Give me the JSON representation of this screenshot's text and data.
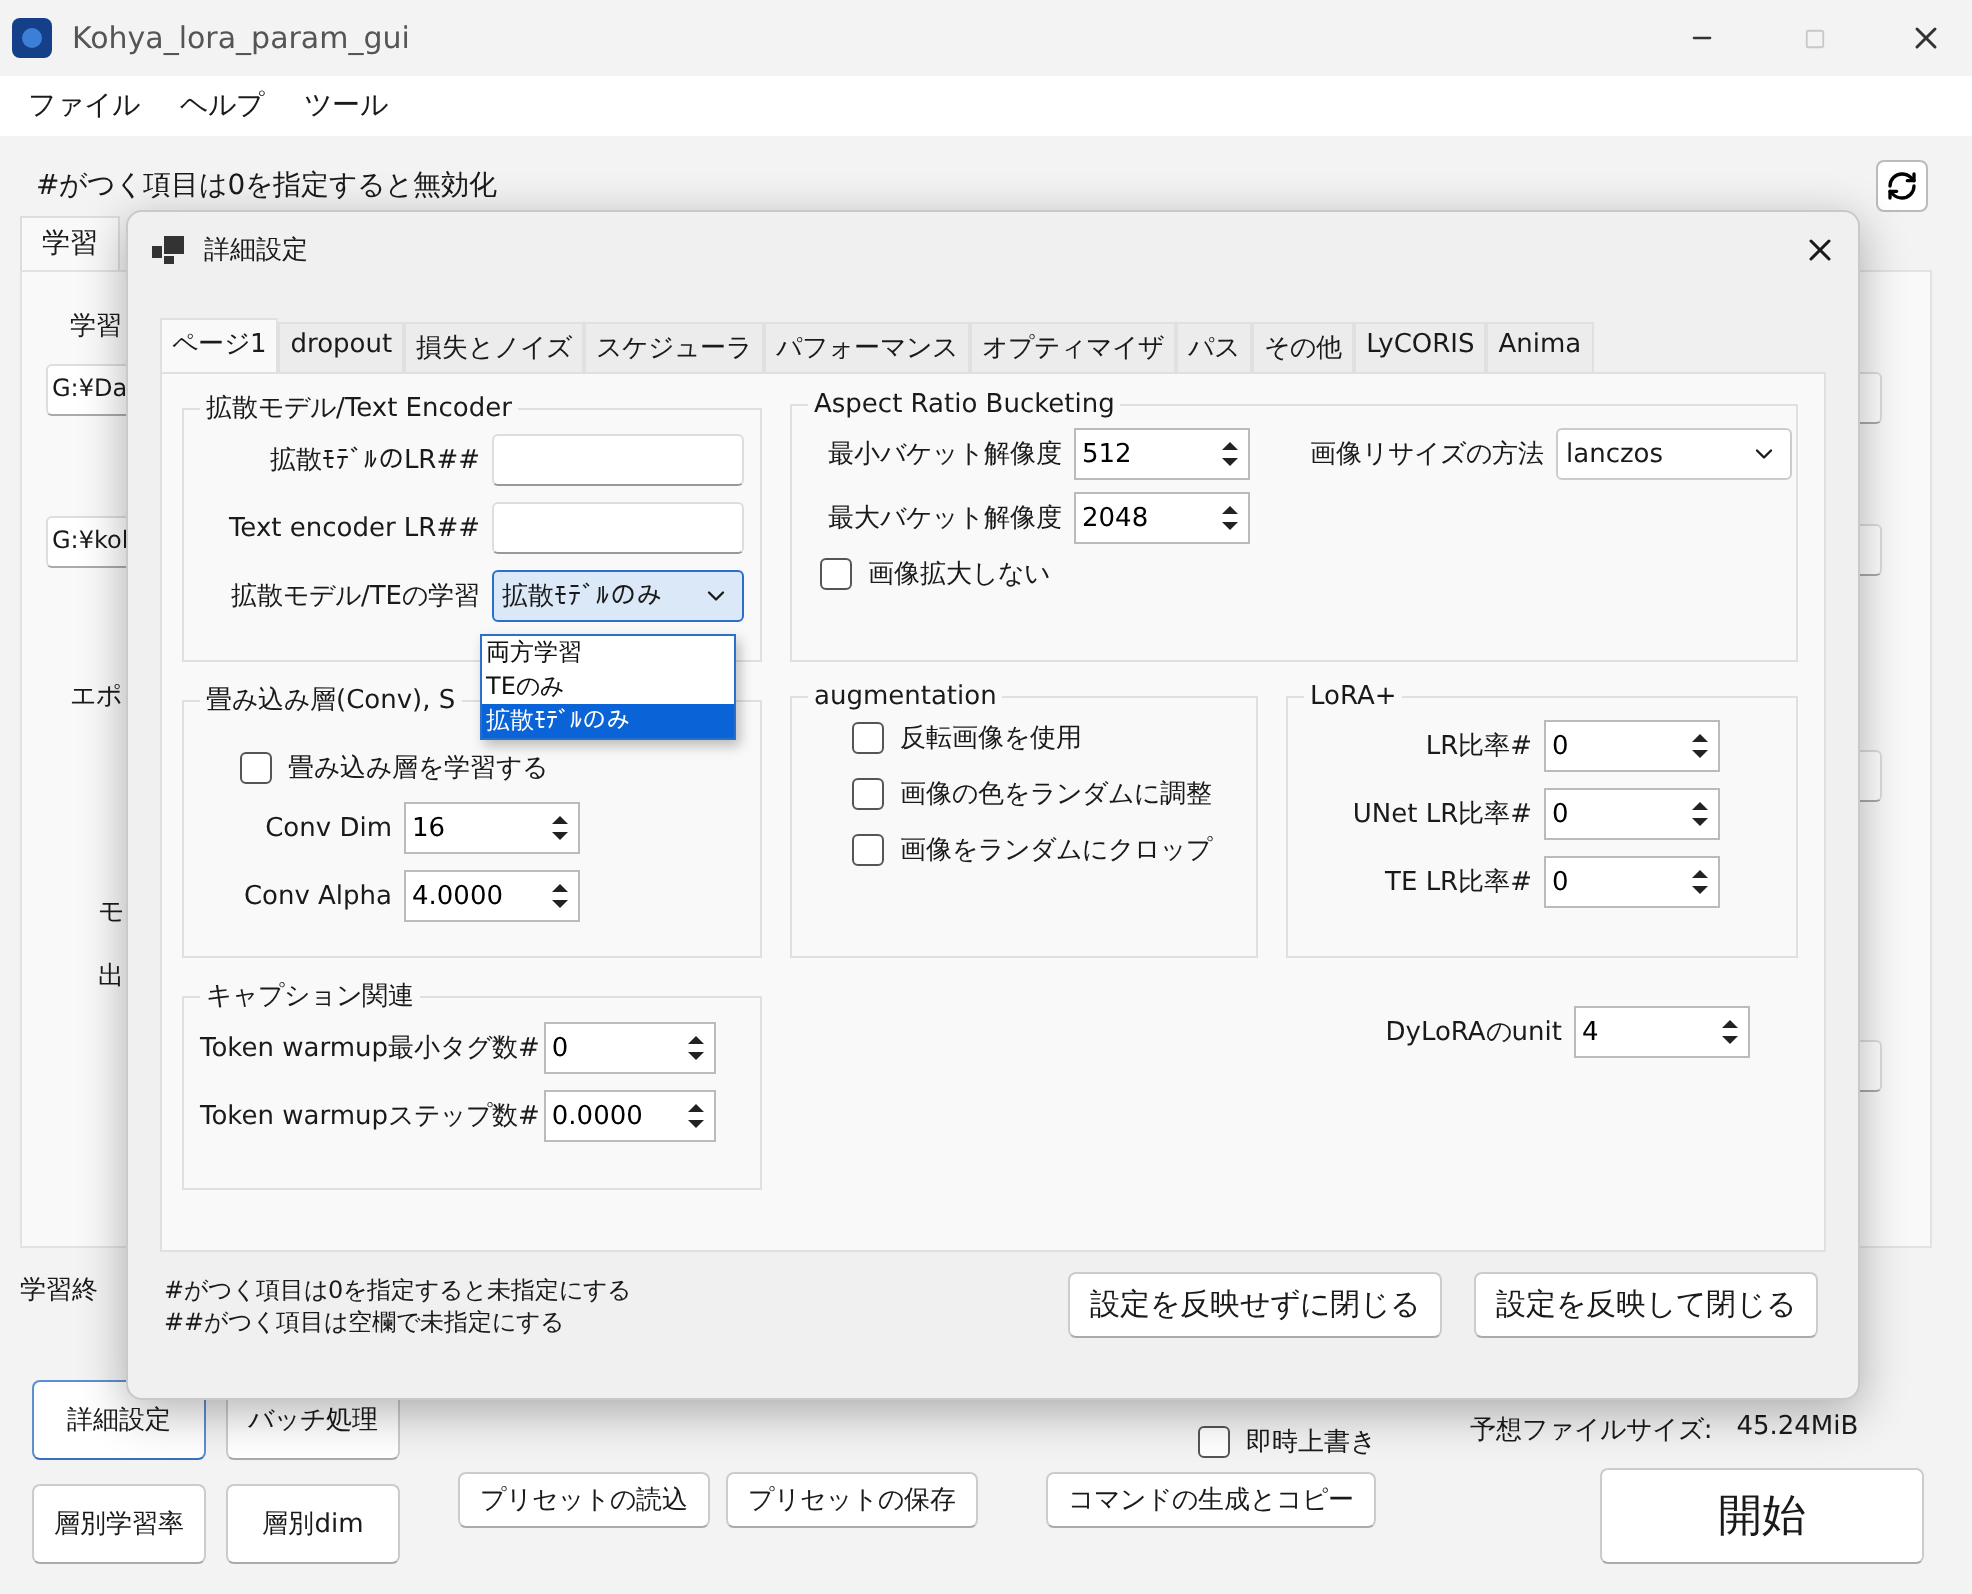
{
  "window": {
    "title": "Kohya_lora_param_gui"
  },
  "menu": [
    "ファイル",
    "ヘルプ",
    "ツール"
  ],
  "main": {
    "hint": "#がつく項目は0を指定すると無効化",
    "tabs": [
      {
        "label": "学習",
        "selected": true
      }
    ],
    "items": [
      {
        "kind": "label",
        "text": "学習"
      },
      {
        "kind": "field",
        "text": "G:¥Da"
      },
      {
        "kind": "field",
        "text": "G:¥kol"
      },
      {
        "kind": "label",
        "text": "エポ"
      },
      {
        "kind": "label",
        "text": "モ"
      },
      {
        "kind": "label",
        "text": "出"
      }
    ],
    "status": "学習終",
    "left_buttons": [
      {
        "label": "詳細設定",
        "focused": true
      },
      {
        "label": "バッチ処理",
        "focused": false
      },
      {
        "label": "層別学習率",
        "focused": false
      },
      {
        "label": "層別dim",
        "focused": false
      }
    ],
    "overwrite": {
      "label": "即時上書き",
      "checked": false
    },
    "file_size": {
      "label": "予想ファイルサイズ:",
      "value": "45.24MiB"
    },
    "preset_buttons": [
      "プリセットの読込",
      "プリセットの保存"
    ],
    "command_button": "コマンドの生成とコピー",
    "start_button": "開始"
  },
  "dialog": {
    "title": "詳細設定",
    "tabs": [
      {
        "label": "ページ1",
        "selected": true
      },
      {
        "label": "dropout",
        "selected": false
      },
      {
        "label": "損失とノイズ",
        "selected": false
      },
      {
        "label": "スケジューラ",
        "selected": false
      },
      {
        "label": "パフォーマンス",
        "selected": false
      },
      {
        "label": "オプティマイザ",
        "selected": false
      },
      {
        "label": "パス",
        "selected": false
      },
      {
        "label": "その他",
        "selected": false
      },
      {
        "label": "LyCORIS",
        "selected": false
      },
      {
        "label": "Anima",
        "selected": false
      }
    ],
    "diffusion": {
      "title": "拡散モデル/Text Encoder",
      "lr_label": "拡散ﾓﾃﾞﾙのLR##",
      "te_lr_label": "Text encoder LR##",
      "train_label": "拡散モデル/TEの学習",
      "train_value": "拡散ﾓﾃﾞﾙのみ",
      "options": [
        {
          "label": "両方学習",
          "selected": false
        },
        {
          "label": "TEのみ",
          "selected": false
        },
        {
          "label": "拡散ﾓﾃﾞﾙのみ",
          "selected": true
        }
      ]
    },
    "conv": {
      "title": "畳み込み層(Conv), S",
      "check": {
        "label": "畳み込み層を学習する",
        "checked": false
      },
      "fields": [
        {
          "label": "Conv Dim",
          "value": "16"
        },
        {
          "label": "Conv Alpha",
          "value": "4.0000"
        }
      ]
    },
    "caption": {
      "title": "キャプション関連",
      "fields": [
        {
          "label": "Token warmup最小タグ数#",
          "value": "0"
        },
        {
          "label": "Token warmupステップ数#",
          "value": "0.0000"
        }
      ]
    },
    "aspect": {
      "title": "Aspect Ratio Bucketing",
      "fields": [
        {
          "label": "最小バケット解像度",
          "value": "512"
        },
        {
          "label": "最大バケット解像度",
          "value": "2048"
        }
      ],
      "resize_label": "画像リサイズの方法",
      "resize_value": "lanczos",
      "check": {
        "label": "画像拡大しない",
        "checked": false
      }
    },
    "augmentation": {
      "title": "augmentation",
      "checks": [
        {
          "label": "反転画像を使用",
          "checked": false
        },
        {
          "label": "画像の色をランダムに調整",
          "checked": false
        },
        {
          "label": "画像をランダムにクロップ",
          "checked": false
        }
      ]
    },
    "lora_plus": {
      "title": "LoRA+",
      "fields": [
        {
          "label": "LR比率#",
          "value": "0"
        },
        {
          "label": "UNet LR比率#",
          "value": "0"
        },
        {
          "label": "TE LR比率#",
          "value": "0"
        }
      ]
    },
    "dylora": {
      "label": "DyLoRAのunit",
      "value": "4"
    },
    "notes": [
      "#がつく項目は0を指定すると未指定にする",
      "##がつく項目は空欄で未指定にする"
    ],
    "buttons": [
      "設定を反映せずに閉じる",
      "設定を反映して閉じる"
    ]
  }
}
